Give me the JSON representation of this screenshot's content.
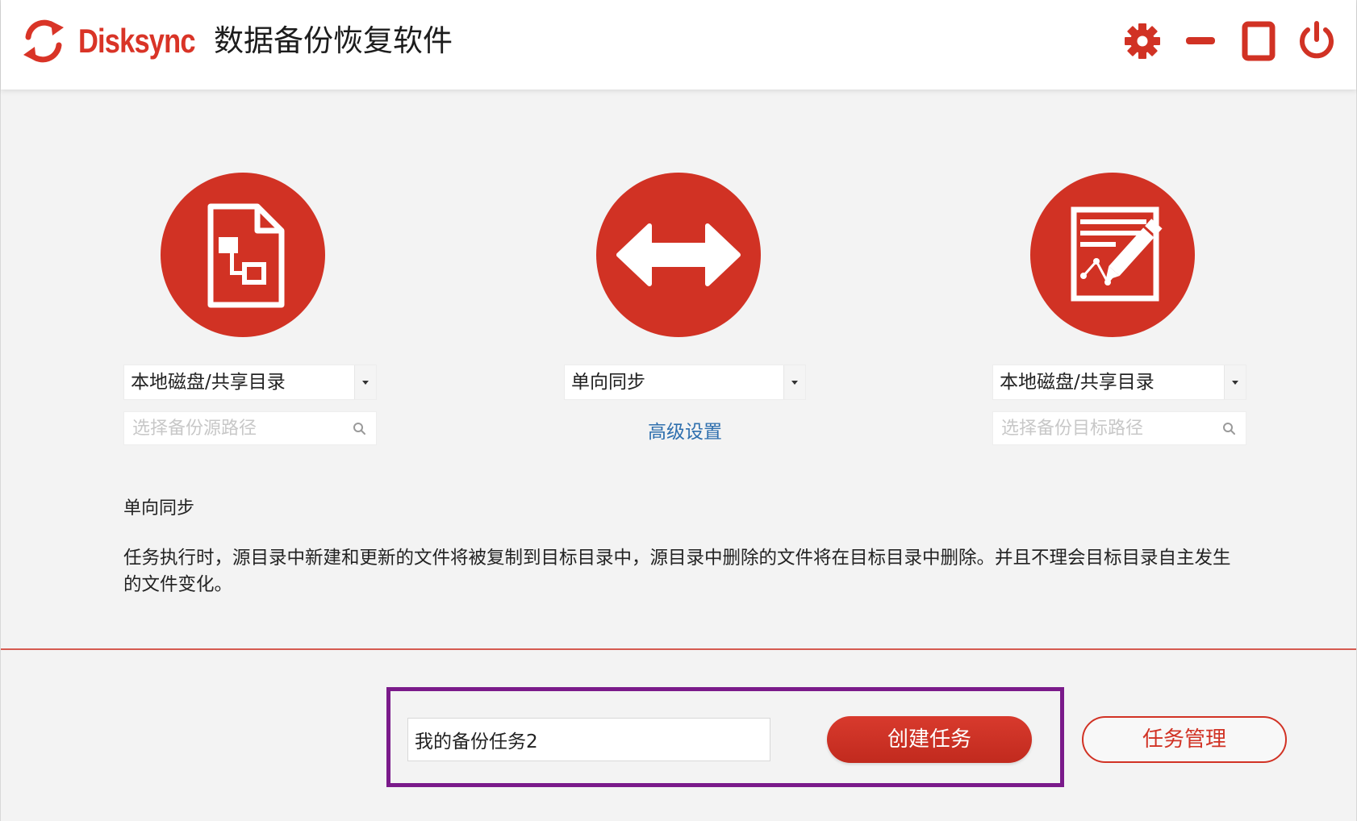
{
  "header": {
    "brand": "Disksync",
    "title": "数据备份恢复软件",
    "icons": [
      "refresh-logo-icon",
      "gear-icon",
      "minimize-icon",
      "maximize-icon",
      "power-icon"
    ]
  },
  "source": {
    "icon": "file-structure-icon",
    "type_selected": "本地磁盘/共享目录",
    "path_placeholder": "选择备份源路径",
    "path_value": ""
  },
  "sync": {
    "icon": "double-arrow-icon",
    "mode_selected": "单向同步",
    "advanced_link": "高级设置"
  },
  "target": {
    "icon": "edit-document-icon",
    "type_selected": "本地磁盘/共享目录",
    "path_placeholder": "选择备份目标路径",
    "path_value": ""
  },
  "description": {
    "title": "单向同步",
    "text": "任务执行时，源目录中新建和更新的文件将被复制到目标目录中，源目录中删除的文件将在目标目录中删除。并且不理会目标目录自主发生的文件变化。"
  },
  "task": {
    "name_value": "我的备份任务2",
    "create_label": "创建任务",
    "manage_label": "任务管理"
  },
  "colors": {
    "accent": "#d13224",
    "link": "#2e6fae",
    "highlight_frame": "#7a1a8a"
  }
}
